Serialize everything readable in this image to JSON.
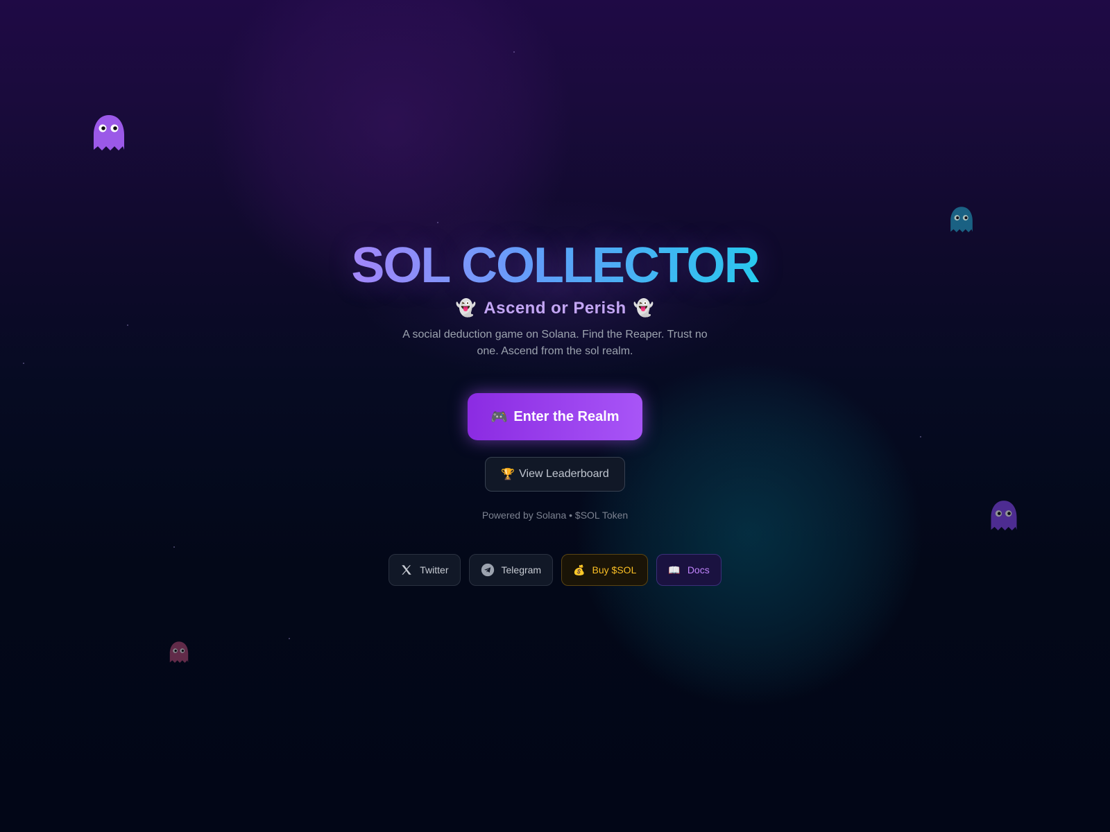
{
  "hero": {
    "title": "SOL COLLECTOR",
    "subtitle_emoji": "👻",
    "subtitle": "Ascend or Perish",
    "description": "A social deduction game on Solana. Find the Reaper. Trust no one. Ascend from the sol realm."
  },
  "actions": {
    "enter_icon": "🎮",
    "enter_label": "Enter the Realm",
    "leaderboard_icon": "🏆",
    "leaderboard_label": "View Leaderboard"
  },
  "footer_text": "Powered by Solana • $SOL Token",
  "links": {
    "twitter": {
      "label": "Twitter",
      "icon": "x-icon"
    },
    "telegram": {
      "label": "Telegram",
      "icon": "telegram-icon"
    },
    "buy": {
      "label": "Buy $SOL",
      "icon_glyph": "💰"
    },
    "docs": {
      "label": "Docs",
      "icon_glyph": "📖"
    }
  },
  "colors": {
    "accent_purple": "#a855f7",
    "title_gradient_start": "#a78bfa",
    "title_gradient_end": "#22d3ee",
    "buy_gold": "#fbbf24",
    "ghost_purple": "#9b59e8",
    "ghost_teal": "#1e7fa0",
    "ghost_pink": "#a0436b"
  }
}
